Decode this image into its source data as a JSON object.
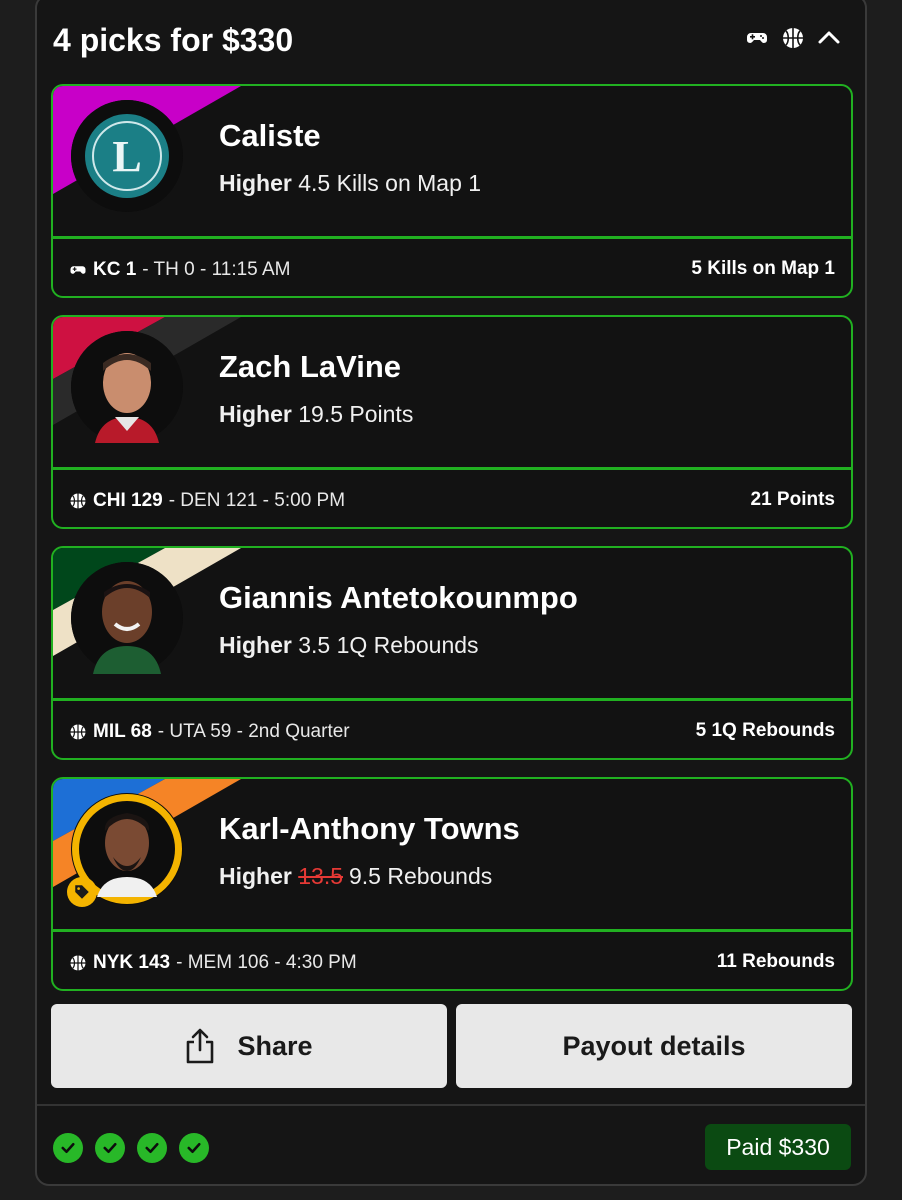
{
  "header": {
    "title": "4 picks for $330",
    "icons": [
      "controller-icon",
      "basketball-icon",
      "chevron-up-icon"
    ]
  },
  "picks": [
    {
      "name": "Caliste",
      "direction": "Higher",
      "line_old": "",
      "line": "4.5",
      "stat": "Kills on Map 1",
      "game_icon": "controller-icon",
      "team_score": "KC 1",
      "game_rest": "- TH 0 - 11:15 AM",
      "result": "5 Kills on Map 1",
      "stripe_color": "#c800c8",
      "avatar_label": "L"
    },
    {
      "name": "Zach LaVine",
      "direction": "Higher",
      "line_old": "",
      "line": "19.5",
      "stat": "Points",
      "game_icon": "basketball-icon",
      "team_score": "CHI 129",
      "game_rest": "- DEN 121 - 5:00 PM",
      "result": "21 Points",
      "stripe_color": "#ce1141"
    },
    {
      "name": "Giannis Antetokounmpo",
      "direction": "Higher",
      "line_old": "",
      "line": "3.5",
      "stat": "1Q Rebounds",
      "game_icon": "basketball-icon",
      "team_score": "MIL 68",
      "game_rest": "- UTA 59 - 2nd Quarter",
      "result": "5 1Q Rebounds",
      "stripe_color": "#00471b"
    },
    {
      "name": "Karl-Anthony Towns",
      "direction": "Higher",
      "line_old": "13.5",
      "line": "9.5",
      "stat": "Rebounds",
      "game_icon": "basketball-icon",
      "team_score": "NYK 143",
      "game_rest": "- MEM 106 - 4:30 PM",
      "result": "11 Rebounds",
      "stripe_color": "#f58426"
    }
  ],
  "actions": {
    "share_label": "Share",
    "payout_label": "Payout details"
  },
  "footer": {
    "check_count": 4,
    "paid_label": "Paid $330"
  },
  "colors": {
    "accent_green": "#21b021",
    "paid_bg": "#0b4a12",
    "strike_red": "#e53935"
  }
}
